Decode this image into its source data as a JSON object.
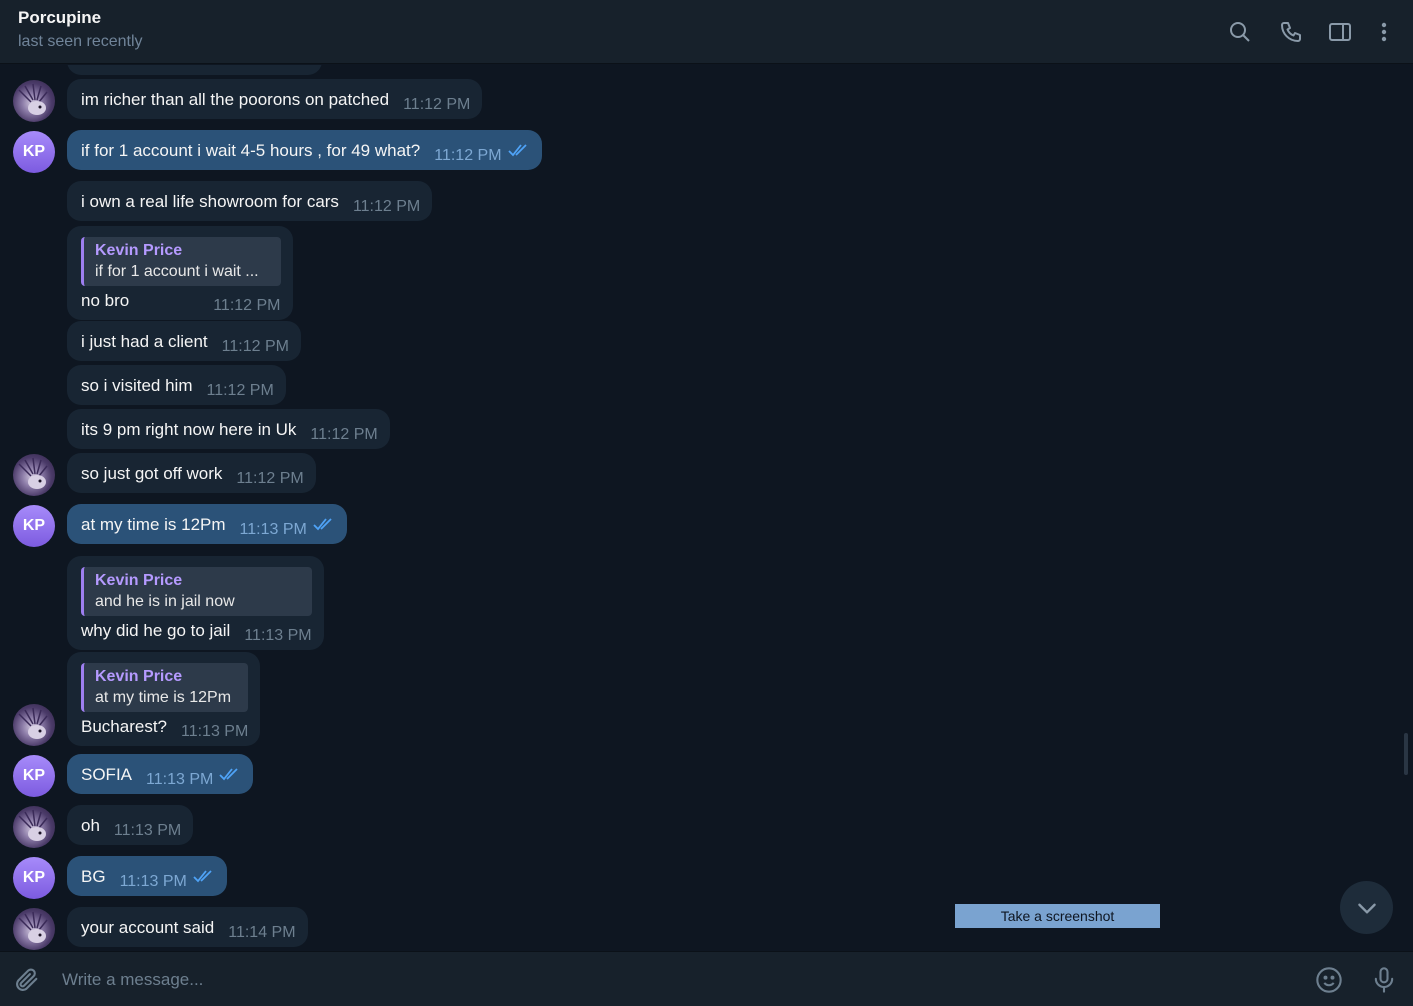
{
  "header": {
    "name": "Porcupine",
    "status": "last seen recently",
    "icons": [
      "search-icon",
      "phone-icon",
      "sidebar-toggle-icon",
      "more-vertical-icon"
    ]
  },
  "colors": {
    "background": "#0e1621",
    "incoming_bubble": "#182533",
    "outgoing_bubble": "#2b5278",
    "accent": "#b59aff",
    "ticks": "#4fa3f7"
  },
  "messages": [
    {
      "direction": "in",
      "text": "im richer than all the poorons on patched",
      "time": "11:12 PM"
    },
    {
      "direction": "out",
      "text": "if for 1 account i wait 4-5 hours , for 49 what?",
      "time": "11:12 PM",
      "avatar": "KP"
    },
    {
      "direction": "in",
      "text": "i own a real life showroom for cars",
      "time": "11:12 PM"
    },
    {
      "direction": "in",
      "text": "no bro",
      "time": "11:12 PM",
      "reply": {
        "name": "Kevin Price",
        "text": "if for 1 account i wait ..."
      }
    },
    {
      "direction": "in",
      "text": "i just had a client",
      "time": "11:12 PM"
    },
    {
      "direction": "in",
      "text": "so i visited him",
      "time": "11:12 PM"
    },
    {
      "direction": "in",
      "text": "its 9 pm right now here in Uk",
      "time": "11:12 PM"
    },
    {
      "direction": "in",
      "text": "so just got off work",
      "time": "11:12 PM"
    },
    {
      "direction": "out",
      "text": "at my time is 12Pm",
      "time": "11:13 PM",
      "avatar": "KP"
    },
    {
      "direction": "in",
      "text": "why did he go to jail",
      "time": "11:13 PM",
      "reply": {
        "name": "Kevin Price",
        "text": "and he is in jail now"
      }
    },
    {
      "direction": "in",
      "text": "Bucharest?",
      "time": "11:13 PM",
      "reply": {
        "name": "Kevin Price",
        "text": "at my time is 12Pm"
      }
    },
    {
      "direction": "out",
      "text": "SOFIA",
      "time": "11:13 PM",
      "avatar": "KP"
    },
    {
      "direction": "in",
      "text": "oh",
      "time": "11:13 PM"
    },
    {
      "direction": "out",
      "text": "BG",
      "time": "11:13 PM",
      "avatar": "KP"
    },
    {
      "direction": "in",
      "text": "your account said",
      "time": "11:14 PM"
    }
  ],
  "overlay": {
    "screenshot_button": "Take a screenshot"
  },
  "composer": {
    "placeholder": "Write a message..."
  }
}
